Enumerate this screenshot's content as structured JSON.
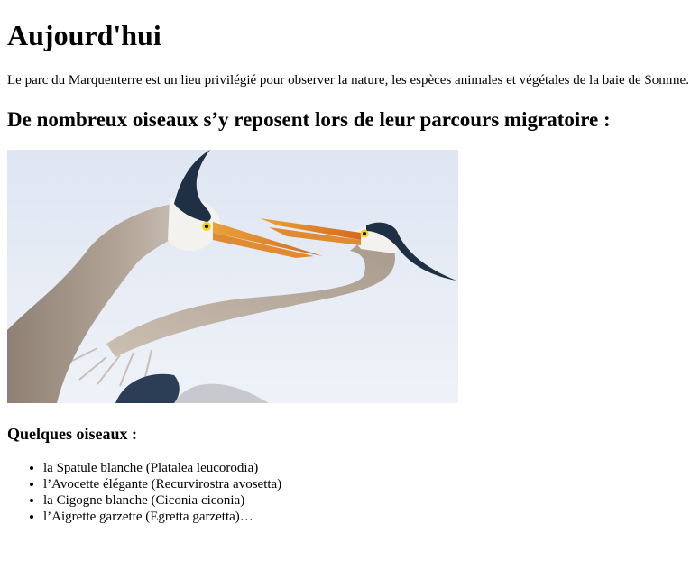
{
  "heading": "Aujourd'hui",
  "intro": "Le parc du Marquenterre est un lieu privilégié pour observer la nature, les espèces animales et végétales de la baie de Somme.",
  "subheading": "De nombreux oiseaux s’y reposent lors de leur parcours migratoire :",
  "image": {
    "alt": "",
    "colors": {
      "sky_top": "#dfe6f2",
      "sky_bottom": "#eef2f8",
      "neck": "#a89a8d",
      "neck_light": "#cfc6bd",
      "head_white": "#f4f2ee",
      "crest": "#1f2f44",
      "beak": "#e9a23a",
      "beak_tip": "#d46a1e",
      "eye": "#f2d21b",
      "body_dark": "#2b3e55"
    }
  },
  "list_title": "Quelques oiseaux :",
  "birds": [
    "la Spatule blanche (Platalea leucorodia)",
    "l’Avocette élégante (Recurvirostra avosetta)",
    "la Cigogne blanche (Ciconia ciconia)",
    "l’Aigrette garzette (Egretta garzetta)…"
  ]
}
